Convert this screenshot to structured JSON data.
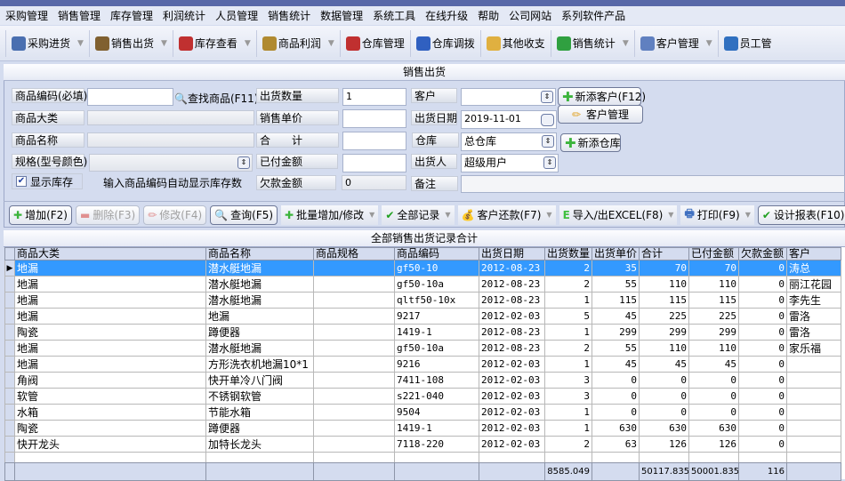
{
  "menu": [
    "采购管理",
    "销售管理",
    "库存管理",
    "利润统计",
    "人员管理",
    "销售统计",
    "数据管理",
    "系统工具",
    "在线升级",
    "帮助",
    "公司网站",
    "系列软件产品"
  ],
  "toolbar": [
    {
      "label": "采购进货",
      "icon": "purchase-icon",
      "color": "#4a6fb0"
    },
    {
      "label": "销售出货",
      "icon": "sales-icon",
      "color": "#806030"
    },
    {
      "label": "库存查看",
      "icon": "inventory-icon",
      "color": "#c03030"
    },
    {
      "label": "商品利润",
      "icon": "money-bag-icon",
      "color": "#b08a30"
    },
    {
      "label": "仓库管理",
      "icon": "warehouse-icon",
      "color": "#c03030"
    },
    {
      "label": "仓库调拨",
      "icon": "transfer-icon",
      "color": "#3060c0"
    },
    {
      "label": "其他收支",
      "icon": "ledger-icon",
      "color": "#e0b040"
    },
    {
      "label": "销售统计",
      "icon": "chart-icon",
      "color": "#30a040"
    },
    {
      "label": "客户管理",
      "icon": "customer-icon",
      "color": "#6080c0"
    },
    {
      "label": "员工管",
      "icon": "staff-icon",
      "color": "#3070c0"
    }
  ],
  "panel": {
    "title": "销售出货",
    "code_label": "商品编码(必填)",
    "code_value": "",
    "find_label": "查找商品(F11)",
    "category_label": "商品大类",
    "name_label": "商品名称",
    "spec_label": "规格(型号颜色)",
    "show_stock_label": "显示库存",
    "show_stock_checked": true,
    "hint": "输入商品编码自动显示库存数",
    "qty_label": "出货数量",
    "qty_value": "1",
    "price_label": "销售单价",
    "price_value": "",
    "total_label": "合　　计",
    "total_value": "",
    "paid_label": "已付金额",
    "paid_value": "",
    "owed_label": "欠款金额",
    "owed_value": "0",
    "customer_label": "客户",
    "customer_value": "",
    "date_label": "出货日期",
    "date_value": "2019-11-01",
    "warehouse_label": "仓库",
    "warehouse_value": "总仓库",
    "shipper_label": "出货人",
    "shipper_value": "超级用户",
    "note_label": "备注",
    "note_value": "",
    "new_customer": "新添客户(F12)",
    "customer_mgmt": "客户管理",
    "new_warehouse": "新添仓库"
  },
  "actions": [
    "增加(F2)",
    "删除(F3)",
    "修改(F4)",
    "查询(F5)",
    "批量增加/修改",
    "全部记录",
    "客户还款(F7)",
    "导入/出EXCEL(F8)",
    "打印(F9)",
    "设计报表(F10)"
  ],
  "grid": {
    "title": "全部销售出货记录合计",
    "columns": [
      "商品大类",
      "商品名称",
      "商品规格",
      "商品编码",
      "出货日期",
      "出货数量",
      "出货单价",
      "合计",
      "已付金额",
      "欠款金额",
      "客户"
    ],
    "rows": [
      [
        "地漏",
        "潜水艇地漏",
        "",
        "gf50-10",
        "2012-08-23",
        "2",
        "35",
        "70",
        "70",
        "0",
        "涛总"
      ],
      [
        "地漏",
        "潜水艇地漏",
        "",
        "gf50-10a",
        "2012-08-23",
        "2",
        "55",
        "110",
        "110",
        "0",
        "丽江花园"
      ],
      [
        "地漏",
        "潜水艇地漏",
        "",
        "qltf50-10x",
        "2012-08-23",
        "1",
        "115",
        "115",
        "115",
        "0",
        "李先生"
      ],
      [
        "地漏",
        "地漏",
        "",
        "9217",
        "2012-02-03",
        "5",
        "45",
        "225",
        "225",
        "0",
        "雷洛"
      ],
      [
        "陶瓷",
        "蹲便器",
        "",
        "1419-1",
        "2012-08-23",
        "1",
        "299",
        "299",
        "299",
        "0",
        "雷洛"
      ],
      [
        "地漏",
        "潜水艇地漏",
        "",
        "gf50-10a",
        "2012-08-23",
        "2",
        "55",
        "110",
        "110",
        "0",
        "家乐福"
      ],
      [
        "地漏",
        "方形洗衣机地漏10*1",
        "",
        "9216",
        "2012-02-03",
        "1",
        "45",
        "45",
        "45",
        "0",
        ""
      ],
      [
        "角阀",
        "快开单冷八门阀",
        "",
        "7411-108",
        "2012-02-03",
        "3",
        "0",
        "0",
        "0",
        "0",
        ""
      ],
      [
        "软管",
        "不锈钢软管",
        "",
        "s221-040",
        "2012-02-03",
        "3",
        "0",
        "0",
        "0",
        "0",
        ""
      ],
      [
        "水箱",
        "节能水箱",
        "",
        "9504",
        "2012-02-03",
        "1",
        "0",
        "0",
        "0",
        "0",
        ""
      ],
      [
        "陶瓷",
        "蹲便器",
        "",
        "1419-1",
        "2012-02-03",
        "1",
        "630",
        "630",
        "630",
        "0",
        ""
      ],
      [
        "快开龙头",
        "加特长龙头",
        "",
        "7118-220",
        "2012-02-03",
        "2",
        "63",
        "126",
        "126",
        "0",
        ""
      ]
    ],
    "selected_row": 0,
    "totals": {
      "qty": "8585.049",
      "total": "50117.835",
      "paid": "50001.835",
      "owed": "116"
    }
  }
}
